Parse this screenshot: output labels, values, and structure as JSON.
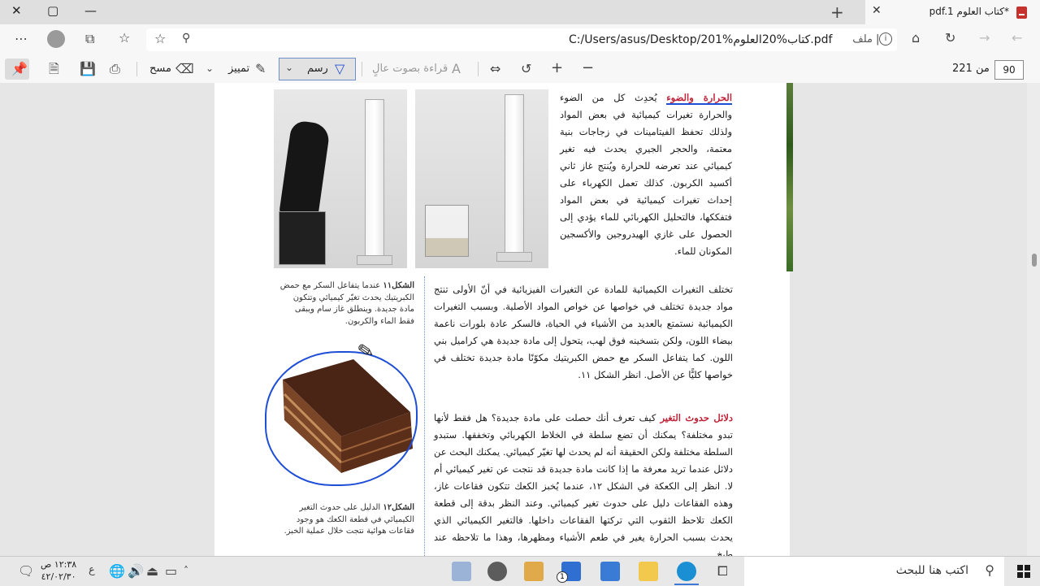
{
  "tab": {
    "title": "*كتاب العلوم pdf.1",
    "close": "✕",
    "new": "+"
  },
  "window": {
    "minimize": "—",
    "maximize": "▢",
    "close": "✕"
  },
  "address": {
    "url": "C:/Users/asus/Desktop/201%كتاب%20العلوم.pdf",
    "scheme_label": "ملف",
    "info": "i"
  },
  "pdf_toolbar": {
    "page_current": "90",
    "page_total": "من 221",
    "read_aloud": "قراءة بصوت عالٍ",
    "draw": "رسم",
    "highlight": "تمييز",
    "erase": "مسح"
  },
  "page": {
    "para1_heading": "الحرارة والضوء",
    "para1": "يُحدِث كل من الضوء والحرارة تغيرات كيميائية في بعض المواد ولذلك تحفظ الفيتامينات في زجاجات بنية معتمة، والحجر الجيري يحدث فيه تغير كيميائي عند تعرضه للحرارة ويُنتج غاز ثاني أكسيد الكربون. كذلك تعمل الكهرباء على إحداث تغيرات كيميائية في بعض المواد فتفككها، فالتحليل الكهربائي للماء يؤدي إلى الحصول على غازي الهيدروجين والأكسجين المكونان للماء.",
    "para2": "تختلف التغيرات الكيميائية للمادة عن التغيرات الفيزيائية في أنّ الأولى تنتج مواد جديدة تختلف في خواصها عن خواص المواد الأصلية. وبسبب التغيرات الكيميائية نستمتع بالعديد من الأشياء في الحياة، فالسكر عادة بلورات ناعمة بيضاء اللون، ولكن بتسخينه فوق لهب، يتحول إلى مادة جديدة هي كراميل بني اللون. كما يتفاعل السكر مع حمض الكبريتيك مكوّنًا مادة جديدة تختلف في خواصها كليًّا عن الأصل. انظر الشكل ١١.",
    "para3_heading": "دلائل حدوث التغير",
    "para3": "كيف تعرف أنك حصلت على مادة جديدة؟ هل فقط لأنها تبدو مختلفة؟ يمكنك أن تضع سلطة في الخلاط الكهربائي وتخفقها. ستبدو السلطة مختلفة ولكن الحقيقة أنه لم يحدث لها تغيّر كيميائي. يمكنك البحث عن دلائل عندما تريد معرفة ما إذا كانت مادة جديدة قد نتجت عن تغير كيميائي أم لا. انظر إلى الكعكة في الشكل ١٢، عندما يُخبز الكعك تتكون فقاعات غاز، وهذه الفقاعات دليل على حدوث تغير كيميائي. وعند النظر بدقة إلى قطعة الكعك تلاحظ الثقوب التي تركتها الفقاعات داخلها. فالتغير الكيميائي الذي يحدث بسبب الحرارة يغير في طعم الأشياء ومظهرها، وهذا ما تلاحظه عند طبخ",
    "fig11_label": "الشكل١١",
    "fig11_caption": "عندما يتفاعل السكر مع حمض الكبريتيك يحدث تغيّر كيميائي وتتكون مادة جديدة. وينطلق غاز سام ويبقى فقط الماء والكربون.",
    "fig12_label": "الشكل١٢",
    "fig12_caption": "الدليل على حدوث التغير الكيميائي في قطعة الكعك هو وجود فقاعات هوائية نتجت خلال عملية الخبز."
  },
  "taskbar": {
    "search_placeholder": "اكتب هنا للبحث",
    "time": "١٢:٣٨ ص",
    "date": "٤٢/٠٢/٣٠",
    "lang": "ع",
    "mail_badge": "1"
  },
  "colors": {
    "accent": "#3b78d8",
    "heading_red": "#c0243a",
    "ink_blue": "#1f4ed6",
    "pdf_red": "#c5312c"
  }
}
